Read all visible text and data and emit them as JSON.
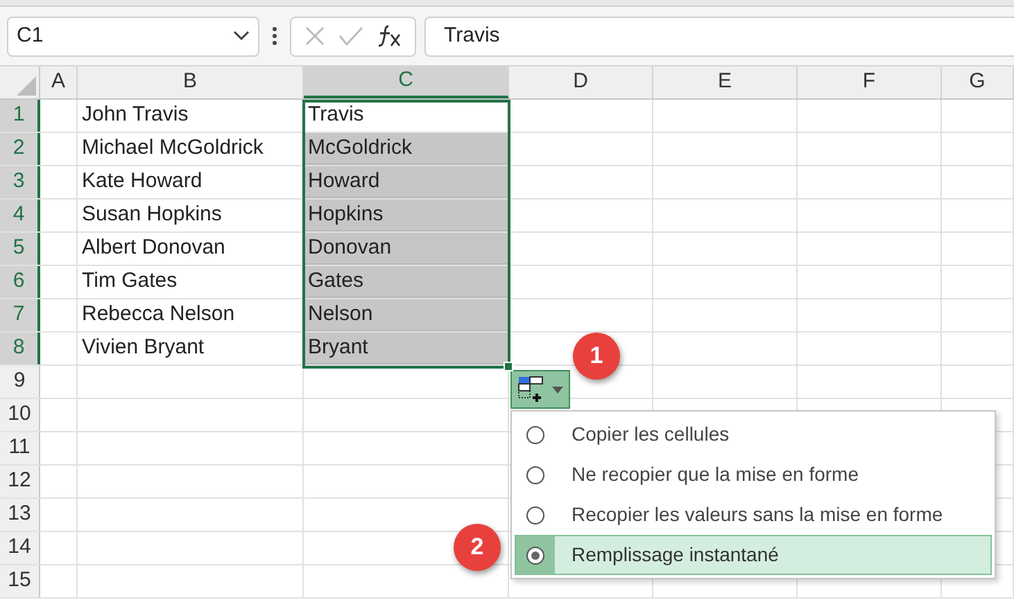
{
  "name_box": {
    "value": "C1"
  },
  "formula_bar": {
    "value": "Travis"
  },
  "columns": [
    {
      "label": "A",
      "selected": false
    },
    {
      "label": "B",
      "selected": false
    },
    {
      "label": "C",
      "selected": true
    },
    {
      "label": "D",
      "selected": false
    },
    {
      "label": "E",
      "selected": false
    },
    {
      "label": "F",
      "selected": false
    },
    {
      "label": "G",
      "selected": false
    }
  ],
  "rows": [
    {
      "number": "1",
      "selected": true,
      "column_b": "John Travis",
      "column_c": {
        "text": "Travis",
        "highlighted": false
      }
    },
    {
      "number": "2",
      "selected": true,
      "column_b": "Michael McGoldrick",
      "column_c": {
        "text": "McGoldrick",
        "highlighted": true
      }
    },
    {
      "number": "3",
      "selected": true,
      "column_b": "Kate Howard",
      "column_c": {
        "text": "Howard",
        "highlighted": true
      }
    },
    {
      "number": "4",
      "selected": true,
      "column_b": "Susan Hopkins",
      "column_c": {
        "text": "Hopkins",
        "highlighted": true
      }
    },
    {
      "number": "5",
      "selected": true,
      "column_b": "Albert Donovan",
      "column_c": {
        "text": "Donovan",
        "highlighted": true
      }
    },
    {
      "number": "6",
      "selected": true,
      "column_b": "Tim Gates",
      "column_c": {
        "text": "Gates",
        "highlighted": true
      }
    },
    {
      "number": "7",
      "selected": true,
      "column_b": "Rebecca Nelson",
      "column_c": {
        "text": "Nelson",
        "highlighted": true
      }
    },
    {
      "number": "8",
      "selected": true,
      "column_b": "Vivien Bryant",
      "column_c": {
        "text": "Bryant",
        "highlighted": true
      }
    },
    {
      "number": "9",
      "selected": false
    },
    {
      "number": "10",
      "selected": false
    },
    {
      "number": "11",
      "selected": false
    },
    {
      "number": "12",
      "selected": false
    },
    {
      "number": "13",
      "selected": false
    },
    {
      "number": "14",
      "selected": false
    },
    {
      "number": "15",
      "selected": false
    }
  ],
  "fill_options_menu": {
    "options": [
      {
        "label": "Copier les cellules",
        "selected": false
      },
      {
        "label": "Ne recopier que la mise en forme",
        "selected": false
      },
      {
        "label": "Recopier les valeurs sans la mise en forme",
        "selected": false
      },
      {
        "label": "Remplissage instantané",
        "selected": true
      }
    ]
  },
  "step_badges": [
    {
      "label": "1"
    },
    {
      "label": "2"
    }
  ]
}
